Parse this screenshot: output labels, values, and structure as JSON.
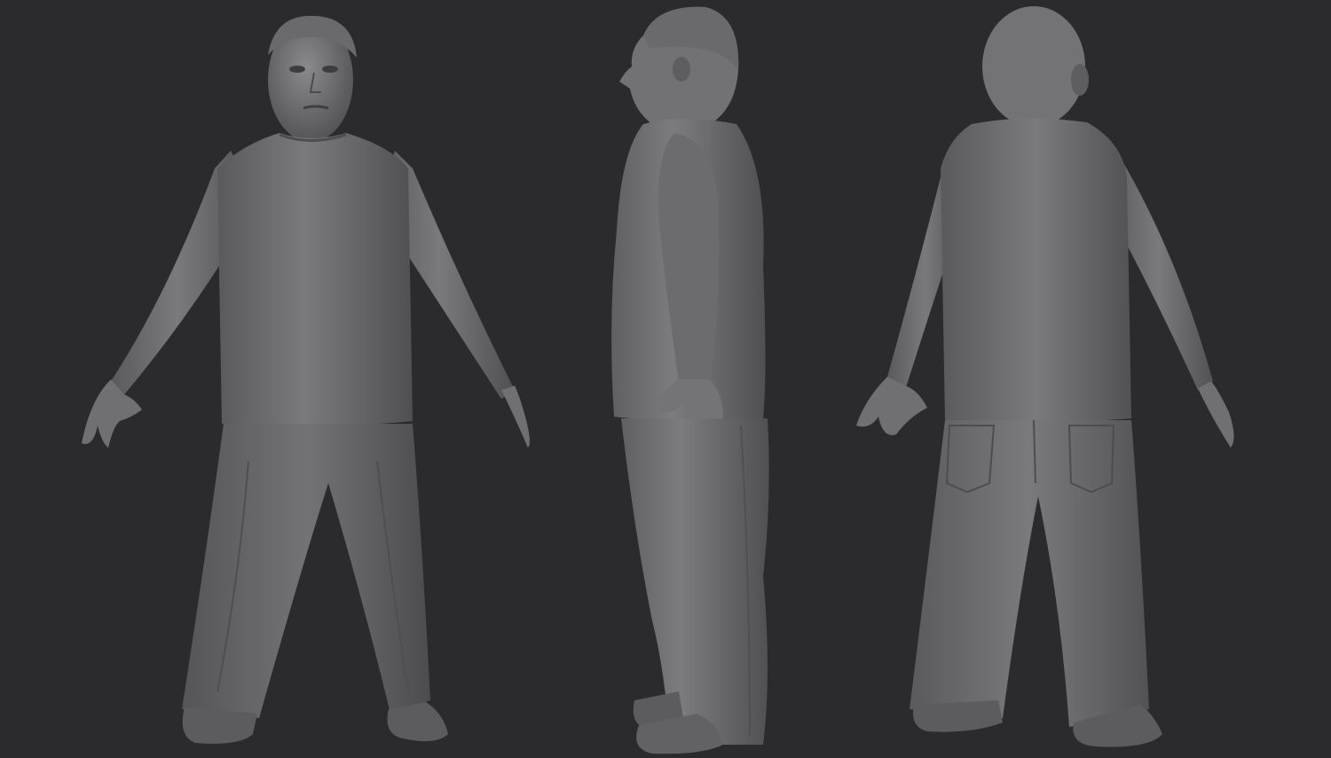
{
  "scene": {
    "background_color": "#2b2b2d",
    "clay_color": "#6e6e70",
    "highlight_color": "#8c8c8e",
    "shadow_color": "#4a4a4c",
    "views": [
      {
        "id": "front",
        "label": ""
      },
      {
        "id": "side",
        "label": ""
      },
      {
        "id": "back",
        "label": ""
      }
    ]
  }
}
